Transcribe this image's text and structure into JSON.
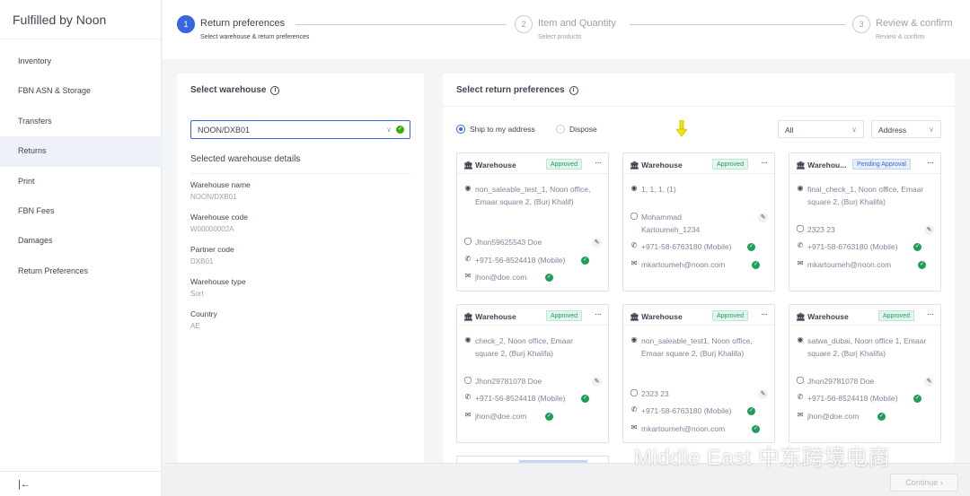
{
  "brand": "Fulfilled by Noon",
  "sidebar": {
    "items": [
      {
        "label": "Inventory"
      },
      {
        "label": "FBN ASN & Storage"
      },
      {
        "label": "Transfers"
      },
      {
        "label": "Returns"
      },
      {
        "label": "Print"
      },
      {
        "label": "FBN Fees"
      },
      {
        "label": "Damages"
      },
      {
        "label": "Return Preferences"
      }
    ],
    "collapse_glyph": "|←"
  },
  "stepper": {
    "steps": [
      {
        "number": "1",
        "title": "Return preferences",
        "subtitle": "Select warehouse & return preferences"
      },
      {
        "number": "2",
        "title": "Item and Quantity",
        "subtitle": "Select products"
      },
      {
        "number": "3",
        "title": "Review & confirm",
        "subtitle": "Review & confirm"
      }
    ]
  },
  "warehouse_panel": {
    "title": "Select warehouse",
    "selected": "NOON/DXB01",
    "details_title": "Selected warehouse details",
    "fields": [
      {
        "label": "Warehouse name",
        "value": "NOON/DXB01"
      },
      {
        "label": "Warehouse code",
        "value": "W00000002A"
      },
      {
        "label": "Partner code",
        "value": "DXB01"
      },
      {
        "label": "Warehouse type",
        "value": "Sort"
      },
      {
        "label": "Country",
        "value": "AE"
      }
    ]
  },
  "prefs_panel": {
    "title": "Select return preferences",
    "option_ship": "Ship to my address",
    "option_dispose": "Dispose",
    "filter_all": "All",
    "filter_address": "Address"
  },
  "cards": [
    {
      "head": "Warehouse",
      "status": "Approved",
      "address": "non_saleable_test_1, Noon office, Emaar square 2, (Burj Khalif)",
      "name": "Jhon59625543 Doe",
      "phone": "+971-56-8524418 (Mobile)",
      "email": "jhon@doe.com"
    },
    {
      "head": "Warehouse",
      "status": "Approved",
      "address": "1, 1, 1, (1)",
      "name": "Mohammad Kartoumeh_1234",
      "phone": "+971-58-6763180 (Mobile)",
      "email": "mkartoumeh@noon.com"
    },
    {
      "head": "Warehou...",
      "status": "Pending Approval",
      "address": "final_check_1, Noon office, Emaar square 2, (Burj Khalifa)",
      "name": "2323 23",
      "phone": "+971-58-6763180 (Mobile)",
      "email": "mkartoumeh@noon.com"
    },
    {
      "head": "Warehouse",
      "status": "Approved",
      "address": "check_2, Noon office, Emaar square 2, (Burj Khalifa)",
      "name": "Jhon29781078 Doe",
      "phone": "+971-56-8524418 (Mobile)",
      "email": "jhon@doe.com"
    },
    {
      "head": "Warehouse",
      "status": "Approved",
      "address": "non_saleable_test1, Noon office, Emaar square 2, (Burj Khalifa)",
      "name": "2323 23",
      "phone": "+971-58-6763180 (Mobile)",
      "email": "mkartoumeh@noon.com"
    },
    {
      "head": "Warehouse",
      "status": "Approved",
      "address": "satwa_dubai, Noon office 1, Emaar square 2, (Burj Khalifa)",
      "name": "Jhon29781078 Doe",
      "phone": "+971-56-8524418 (Mobile)",
      "email": "jhon@doe.com"
    }
  ],
  "footer": {
    "continue_label": "Continue"
  },
  "watermark": "Middle East 中东跨境电商",
  "colors": {
    "accent": "#3866df",
    "approved": "#1e9e5a",
    "arrow": "#f5e400"
  }
}
